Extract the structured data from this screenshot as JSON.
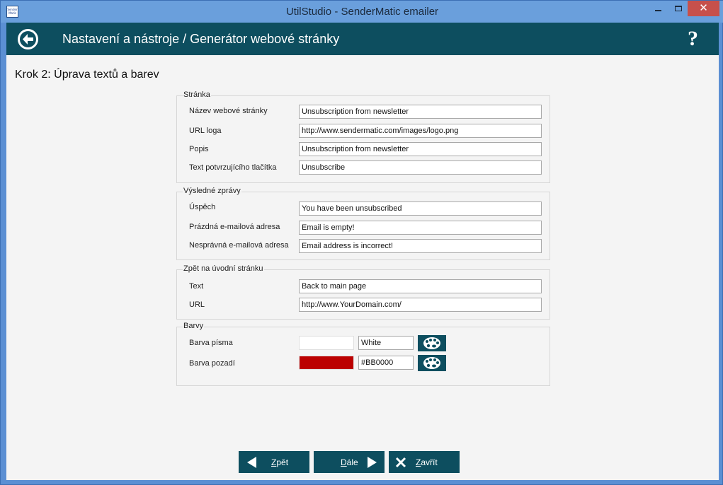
{
  "window": {
    "title": "UtilStudio - SenderMatic emailer",
    "icon_text": "Sender Matic",
    "close_glyph": "✕"
  },
  "header": {
    "title": "Nastavení a nástroje / Generátor webové stránky",
    "help_glyph": "?",
    "back_icon": "back-arrow-circle-icon",
    "background": "#0d4e5f"
  },
  "step_title": "Krok 2: Úprava textů a barev",
  "groups": {
    "page": {
      "legend": "Stránka",
      "rows": [
        {
          "label": "Název webové stránky",
          "value": "Unsubscription from newsletter"
        },
        {
          "label": "URL loga",
          "value": "http://www.sendermatic.com/images/logo.png"
        },
        {
          "label": "Popis",
          "value": "Unsubscription from newsletter"
        },
        {
          "label": "Text potvrzujícího tlačítka",
          "value": "Unsubscribe"
        }
      ]
    },
    "messages": {
      "legend": "Výsledné zprávy",
      "rows": [
        {
          "label": "Úspěch",
          "value": "You have been unsubscribed"
        },
        {
          "label": "Prázdná e-mailová adresa",
          "value": "Email is empty!"
        },
        {
          "label": "Nesprávná e-mailová adresa",
          "value": "Email address is incorrect!"
        }
      ]
    },
    "back_link": {
      "legend": "Zpět na úvodní stránku",
      "rows": [
        {
          "label": "Text",
          "value": "Back to main page"
        },
        {
          "label": "URL",
          "value": "http://www.YourDomain.com/"
        }
      ]
    },
    "colors": {
      "legend": "Barvy",
      "rows": [
        {
          "label": "Barva písma",
          "value": "White",
          "swatch": "#ffffff"
        },
        {
          "label": "Barva pozadí",
          "value": "#BB0000",
          "swatch": "#bb0000"
        }
      ]
    }
  },
  "footer": {
    "back_label_u": "Z",
    "back_label_rest": "pět",
    "next_label_u": "D",
    "next_label_rest": "ále",
    "close_label_u": "Z",
    "close_label_rest": "avřít"
  }
}
